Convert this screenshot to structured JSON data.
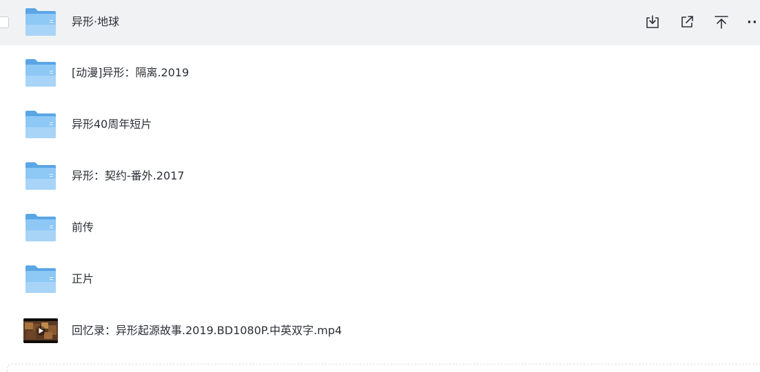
{
  "files": [
    {
      "type": "folder",
      "name": "异形·地球"
    },
    {
      "type": "folder",
      "name": "[动漫]异形：隔离.2019"
    },
    {
      "type": "folder",
      "name": "异形40周年短片"
    },
    {
      "type": "folder",
      "name": "异形：契约-番外.2017"
    },
    {
      "type": "folder",
      "name": "前传"
    },
    {
      "type": "folder",
      "name": "正片"
    },
    {
      "type": "video",
      "name": "回忆录：异形起源故事.2019.BD1080P.中英双字.mp4"
    }
  ],
  "row_actions": [
    {
      "icon": "download-icon"
    },
    {
      "icon": "share-icon"
    },
    {
      "icon": "move-to-top-icon"
    },
    {
      "icon": "more-icon",
      "label": "··"
    }
  ],
  "colors": {
    "hover_row": "#f1f2f4",
    "folder_front": "#8ec8f5",
    "folder_back": "#5aa6e6",
    "text": "#2b2f36"
  }
}
